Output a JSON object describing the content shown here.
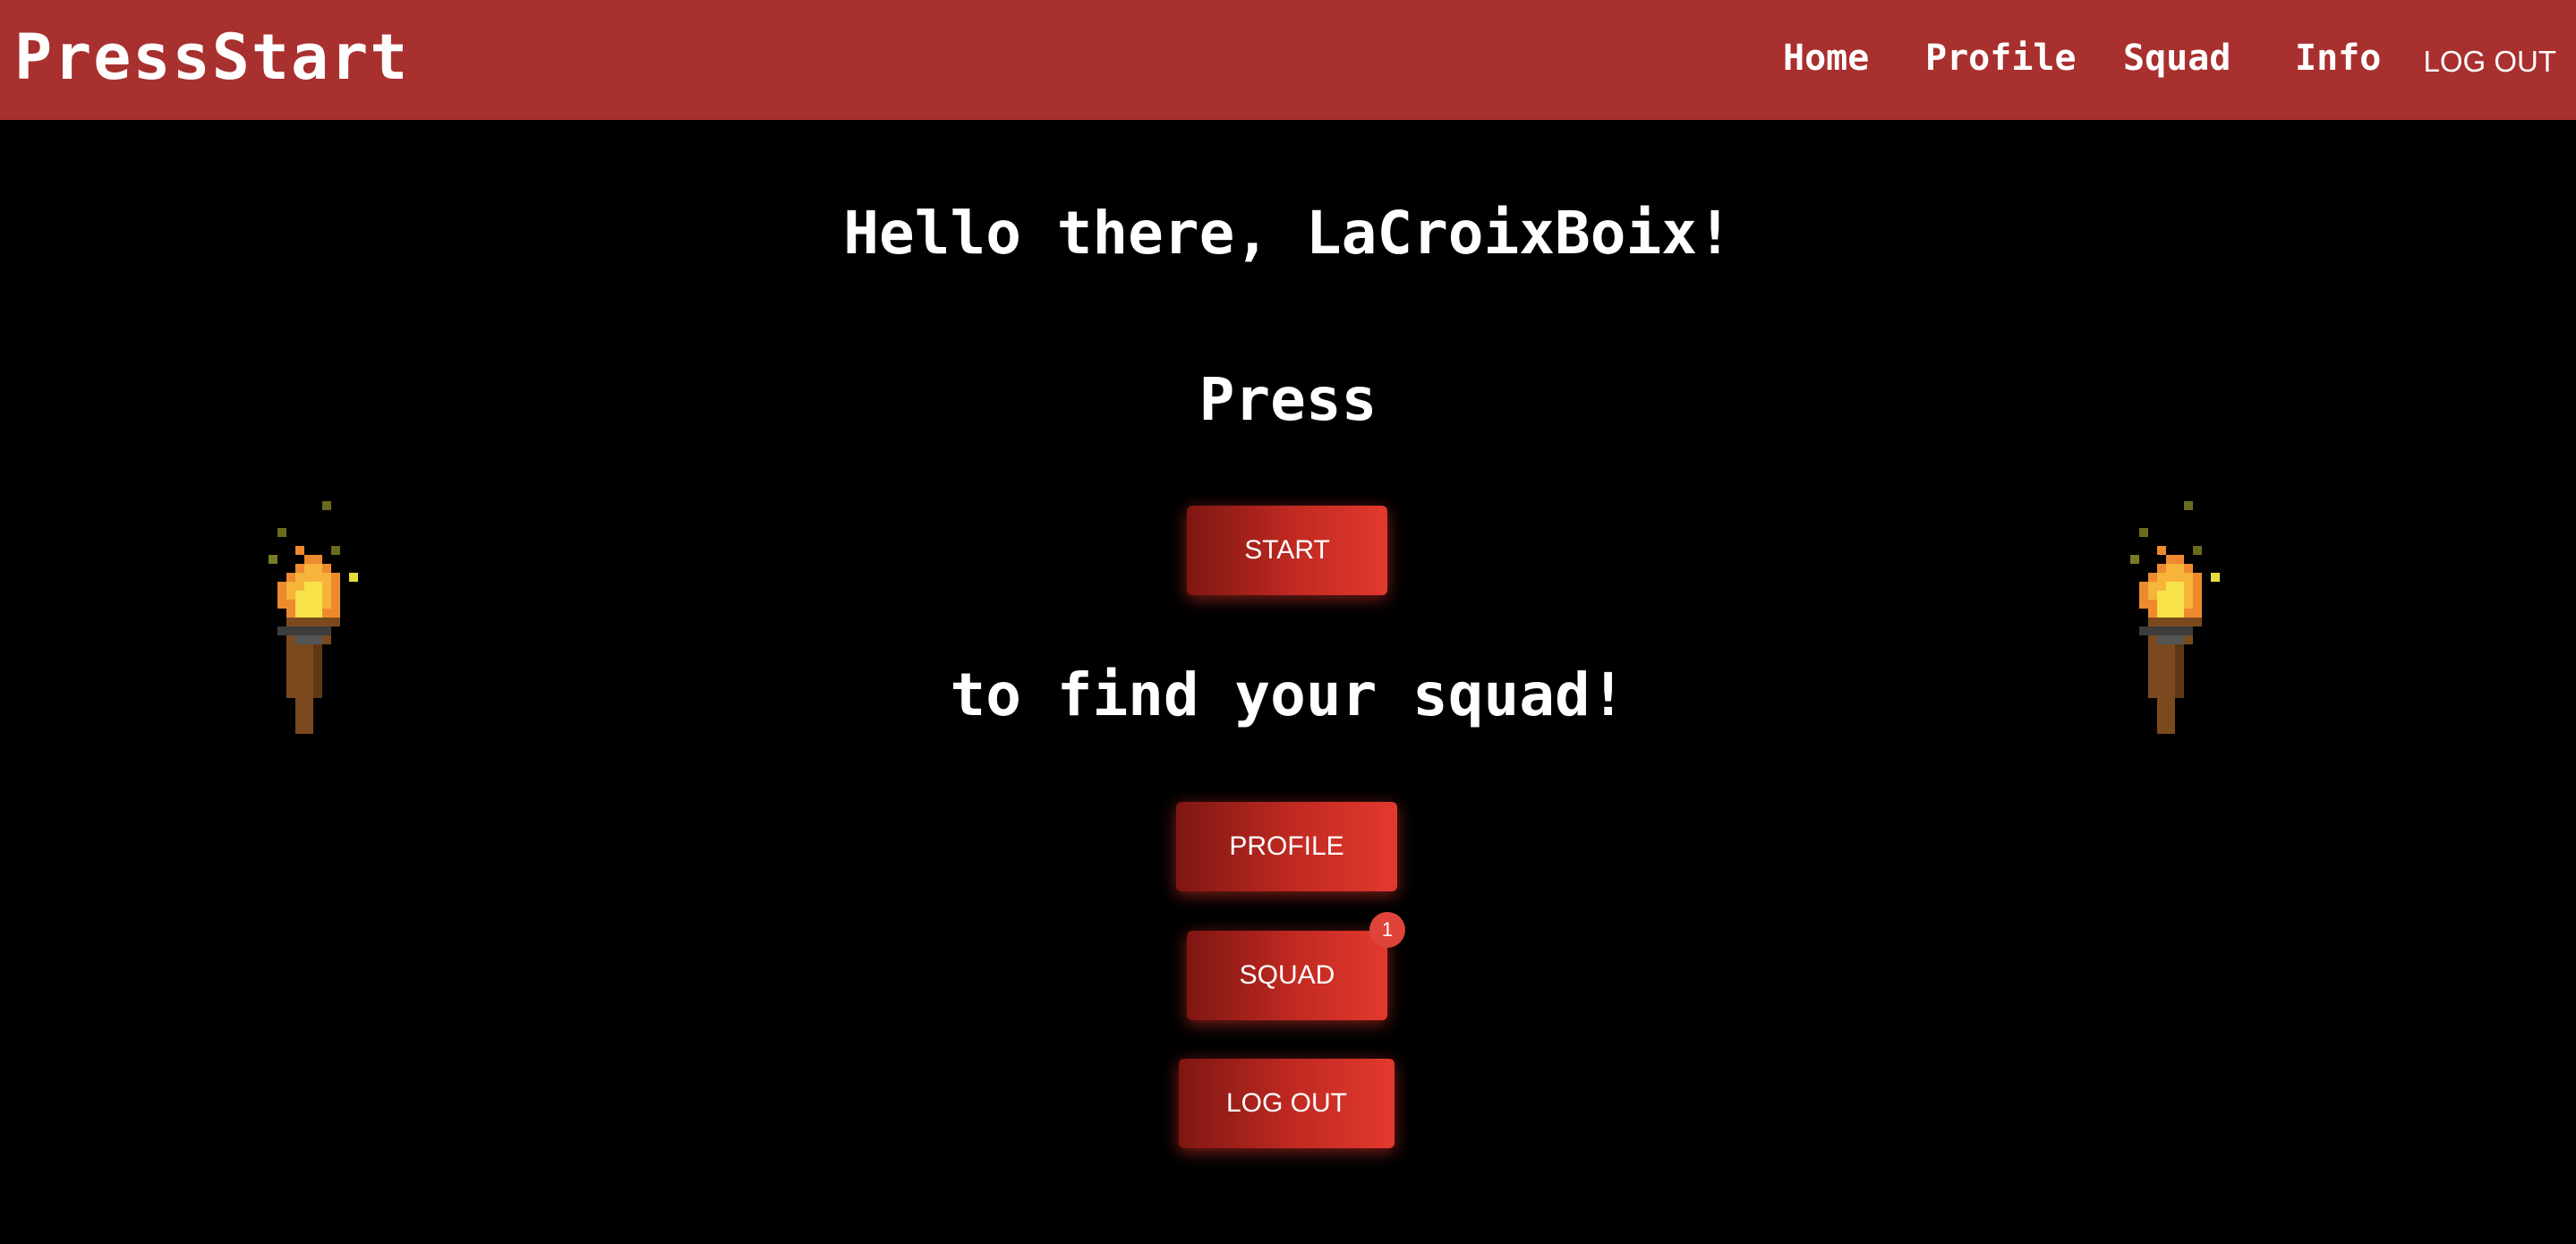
{
  "navbar": {
    "brand": "PressStart",
    "links": [
      "Home",
      "Profile",
      "Squad",
      "Info"
    ],
    "logout": "LOG OUT",
    "color": "#a8302e"
  },
  "main": {
    "greeting": "Hello there, LaCroixBoix!",
    "press_text": "Press",
    "start_button": "START",
    "tagline": "to find your squad!",
    "profile_button": "PROFILE",
    "squad_button": "SQUAD",
    "squad_badge": "1",
    "logout_button": "LOG OUT"
  },
  "decorations": {
    "left_torch_icon": "torch-icon",
    "right_torch_icon": "torch-icon"
  },
  "colors": {
    "background": "#000000",
    "accent": "#e3392d",
    "badge": "#e0433a"
  }
}
